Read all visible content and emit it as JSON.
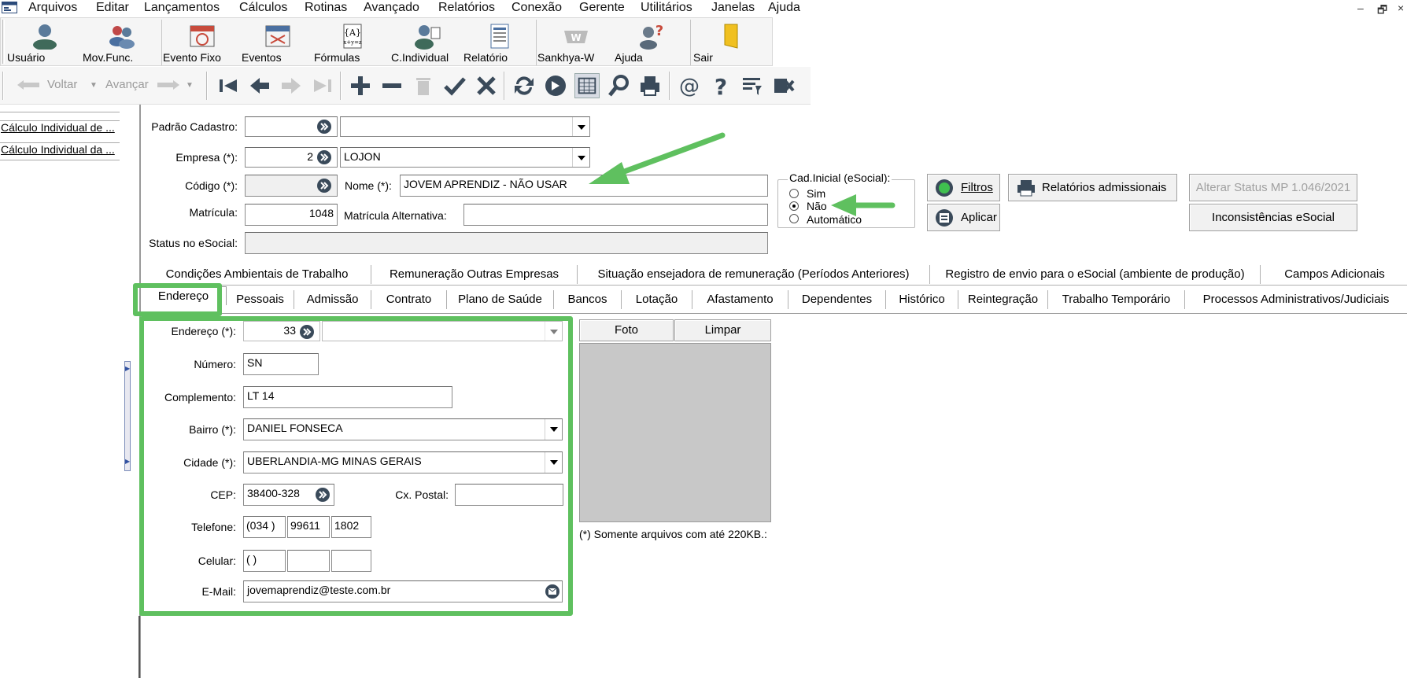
{
  "menu": {
    "items": [
      "Arquivos",
      "Editar",
      "Lançamentos",
      "Cálculos",
      "Rotinas",
      "Avançado",
      "Relatórios",
      "Conexão",
      "Gerente",
      "Utilitários",
      "Janelas",
      "Ajuda"
    ],
    "window_controls": [
      "–",
      "🗗",
      "×"
    ]
  },
  "toolbar_big": {
    "buttons": [
      {
        "label": "Usuário",
        "icon": "user-icon"
      },
      {
        "label": "Mov.Func.",
        "icon": "employee-movement-icon"
      },
      {
        "label": "Evento Fixo",
        "icon": "fixed-event-icon"
      },
      {
        "label": "Eventos",
        "icon": "events-icon"
      },
      {
        "label": "Fórmulas",
        "icon": "formulas-icon"
      },
      {
        "label": "C.Individual",
        "icon": "individual-calc-icon"
      },
      {
        "label": "Relatório",
        "icon": "report-icon"
      },
      {
        "label": "Sankhya-W",
        "icon": "sankhya-icon"
      },
      {
        "label": "Ajuda",
        "icon": "help-person-icon"
      },
      {
        "label": "Sair",
        "icon": "exit-icon"
      }
    ]
  },
  "toolbar_small": {
    "back_label": "Voltar",
    "forward_label": "Avançar"
  },
  "left_panel": {
    "items": [
      "Cálculo Individual de ...",
      "Cálculo Individual da ..."
    ]
  },
  "form": {
    "padrao_label": "Padrão Cadastro:",
    "padrao_value": "",
    "padrao_desc": "",
    "empresa_label": "Empresa (*):",
    "empresa_value": "2",
    "empresa_desc": "LOJON",
    "codigo_label": "Código (*):",
    "codigo_value": "",
    "nome_label": "Nome (*):",
    "nome_value": "JOVEM APRENDIZ -  NÃO USAR",
    "matricula_label": "Matrícula:",
    "matricula_value": "1048",
    "matricula_alt_label": "Matrícula Alternativa:",
    "matricula_alt_value": "",
    "status_label": "Status no eSocial:",
    "status_value": ""
  },
  "cad_inicial": {
    "title": "Cad.Inicial (eSocial):",
    "options": [
      "Sim",
      "Não",
      "Automático"
    ],
    "selected": "Não"
  },
  "buttons": {
    "filtros": "Filtros",
    "aplicar": "Aplicar",
    "relatorios_admissionais": "Relatórios admissionais",
    "alterar_status": "Alterar Status MP 1.046/2021",
    "inconsistencias": "Inconsistências eSocial"
  },
  "tabs_row1": [
    "Condições Ambientais de Trabalho",
    "Remuneração Outras Empresas",
    "Situação ensejadora de remuneração (Períodos Anteriores)",
    "Registro de envio para o eSocial (ambiente de produção)",
    "Campos Adicionais"
  ],
  "tabs_row2": [
    "Endereço",
    "Pessoais",
    "Admissão",
    "Contrato",
    "Plano de Saúde",
    "Bancos",
    "Lotação",
    "Afastamento",
    "Dependentes",
    "Histórico",
    "Reintegração",
    "Trabalho Temporário",
    "Processos Administrativos/Judiciais"
  ],
  "address": {
    "endereco_label": "Endereço (*):",
    "endereco_code": "33",
    "endereco_desc": "",
    "numero_label": "Número:",
    "numero_value": "SN",
    "complemento_label": "Complemento:",
    "complemento_value": "LT 14",
    "bairro_label": "Bairro (*):",
    "bairro_value": "DANIEL FONSECA",
    "cidade_label": "Cidade (*):",
    "cidade_value": "UBERLANDIA-MG MINAS GERAIS",
    "cep_label": "CEP:",
    "cep_value": "38400-328",
    "cxpostal_label": "Cx. Postal:",
    "cxpostal_value": "",
    "telefone_label": "Telefone:",
    "telefone_ddd": "(034 )",
    "telefone_prefix": "99611",
    "telefone_suffix": "1802",
    "celular_label": "Celular:",
    "celular_ddd": "(   )",
    "celular_prefix": "",
    "celular_suffix": "",
    "email_label": "E-Mail:",
    "email_value": "jovemaprendiz@teste.com.br"
  },
  "photo": {
    "foto_button": "Foto",
    "limpar_button": "Limpar",
    "note": "(*) Somente arquivos com até 220KB.:"
  },
  "colors": {
    "highlight_green": "#5fc05f",
    "toolbar_bg": "#f5f5f5",
    "photo_bg": "#c8c8c8"
  }
}
